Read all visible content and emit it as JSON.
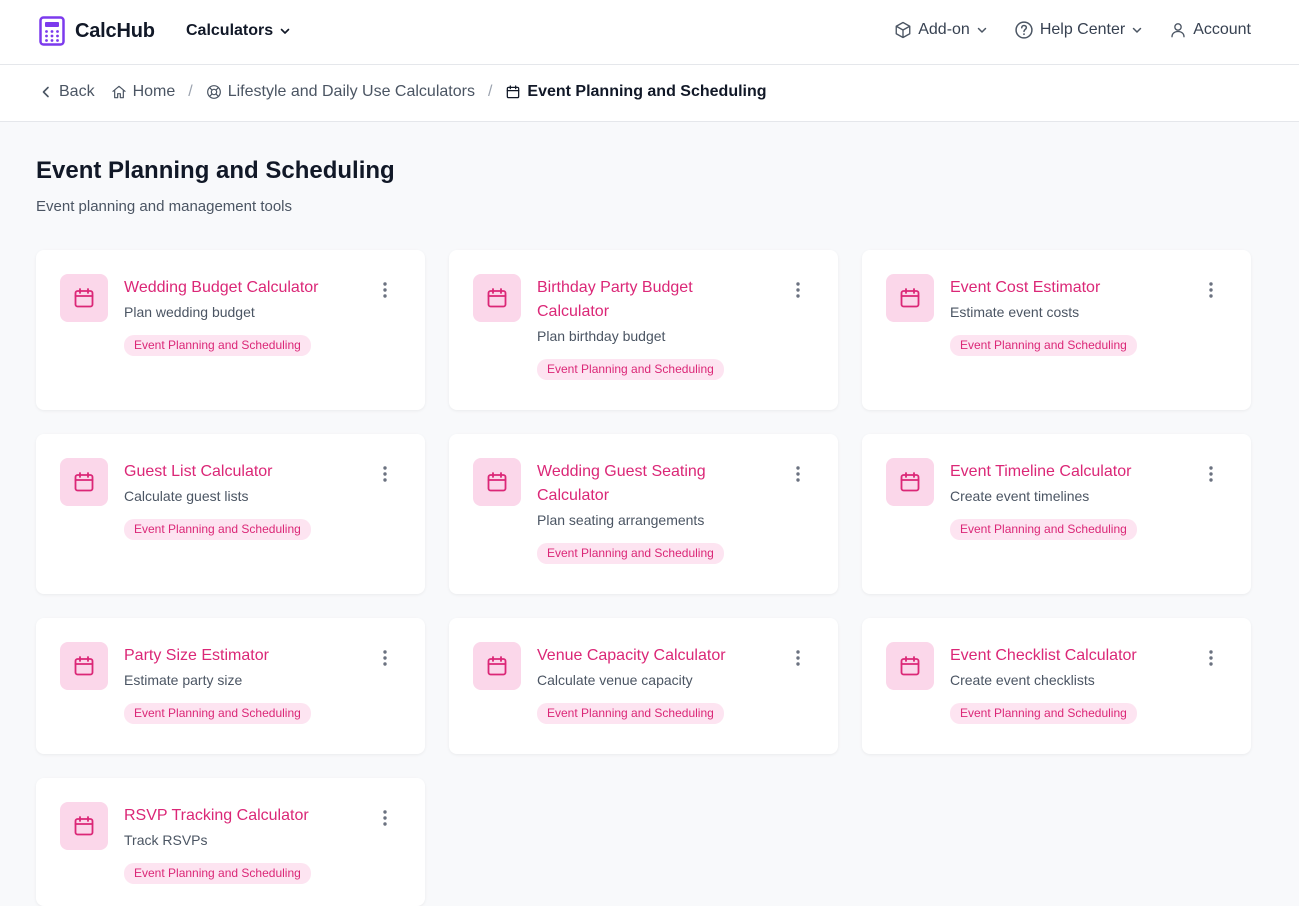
{
  "header": {
    "brand": "CalcHub",
    "calculators_menu": "Calculators",
    "addon": "Add-on",
    "help": "Help Center",
    "account": "Account"
  },
  "breadcrumb": {
    "back": "Back",
    "home": "Home",
    "category": "Lifestyle and Daily Use Calculators",
    "current": "Event Planning and Scheduling"
  },
  "page": {
    "title": "Event Planning and Scheduling",
    "subtitle": "Event planning and management tools"
  },
  "colors": {
    "accent": "#db2777",
    "icon_bg": "#fbd7ea",
    "tag_bg": "#fde4f1"
  },
  "cards": [
    {
      "title": "Wedding Budget Calculator",
      "description": "Plan wedding budget",
      "tag": "Event Planning and Scheduling",
      "icon": "calendar-icon"
    },
    {
      "title": "Birthday Party Budget Calculator",
      "description": "Plan birthday budget",
      "tag": "Event Planning and Scheduling",
      "icon": "calendar-icon"
    },
    {
      "title": "Event Cost Estimator",
      "description": "Estimate event costs",
      "tag": "Event Planning and Scheduling",
      "icon": "calendar-icon"
    },
    {
      "title": "Guest List Calculator",
      "description": "Calculate guest lists",
      "tag": "Event Planning and Scheduling",
      "icon": "calendar-icon"
    },
    {
      "title": "Wedding Guest Seating Calculator",
      "description": "Plan seating arrangements",
      "tag": "Event Planning and Scheduling",
      "icon": "calendar-icon"
    },
    {
      "title": "Event Timeline Calculator",
      "description": "Create event timelines",
      "tag": "Event Planning and Scheduling",
      "icon": "calendar-icon"
    },
    {
      "title": "Party Size Estimator",
      "description": "Estimate party size",
      "tag": "Event Planning and Scheduling",
      "icon": "calendar-icon"
    },
    {
      "title": "Venue Capacity Calculator",
      "description": "Calculate venue capacity",
      "tag": "Event Planning and Scheduling",
      "icon": "calendar-icon"
    },
    {
      "title": "Event Checklist Calculator",
      "description": "Create event checklists",
      "tag": "Event Planning and Scheduling",
      "icon": "calendar-icon"
    },
    {
      "title": "RSVP Tracking Calculator",
      "description": "Track RSVPs",
      "tag": "Event Planning and Scheduling",
      "icon": "calendar-icon"
    }
  ]
}
